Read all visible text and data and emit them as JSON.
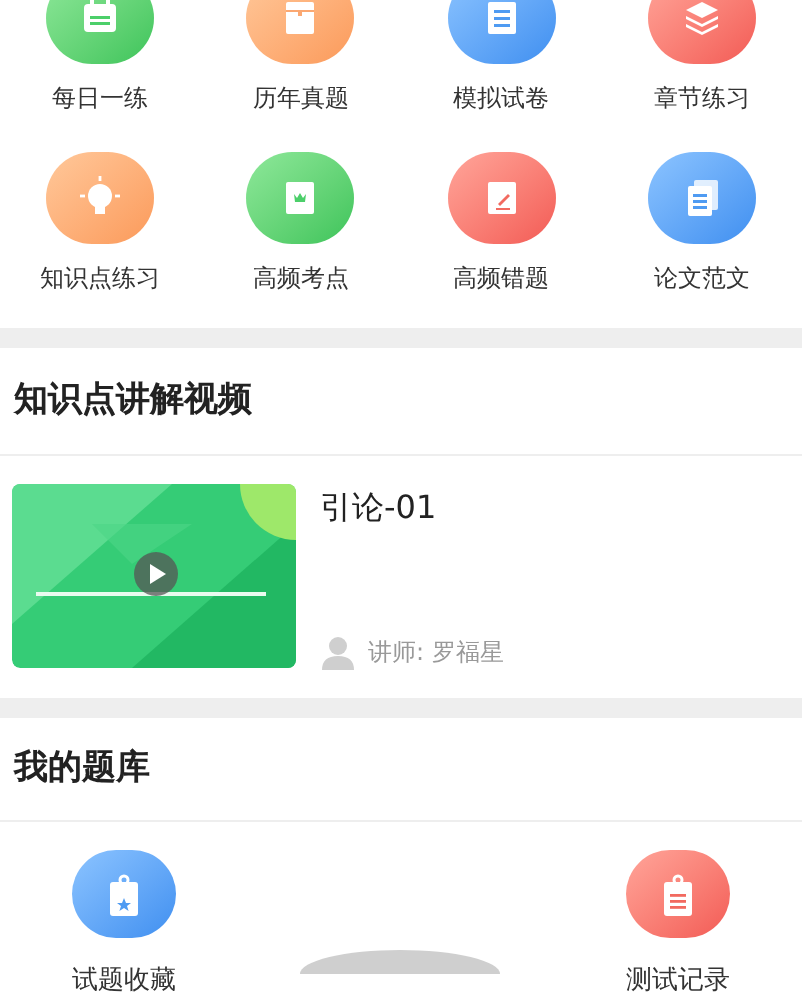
{
  "shortcuts": [
    {
      "label": "每日一练"
    },
    {
      "label": "历年真题"
    },
    {
      "label": "模拟试卷"
    },
    {
      "label": "章节练习"
    },
    {
      "label": "知识点练习"
    },
    {
      "label": "高频考点"
    },
    {
      "label": "高频错题"
    },
    {
      "label": "论文范文"
    }
  ],
  "video_section": {
    "title": "知识点讲解视频",
    "videos": [
      {
        "kind": "picture",
        "title": "引论-01",
        "teacher": "讲师: 罗福星"
      }
    ]
  },
  "bank_section": {
    "title": "我的题库",
    "items": [
      {
        "label": "试题收藏"
      },
      {
        "label": "测试记录"
      }
    ]
  }
}
